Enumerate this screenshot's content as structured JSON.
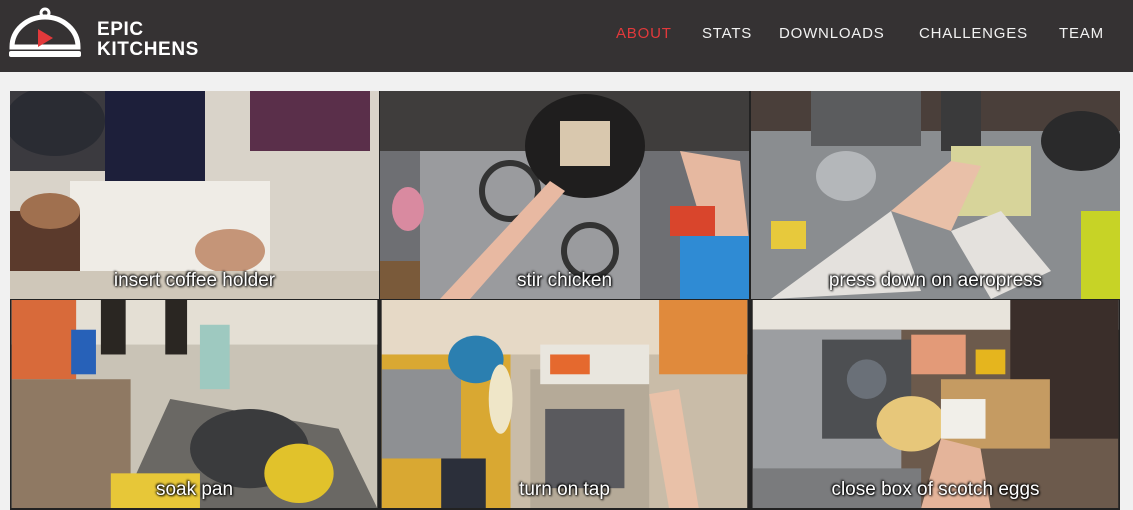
{
  "brand": {
    "line1": "EPIC",
    "line2": "KITCHENS",
    "logo_icon": "cloche-play-icon",
    "accent_color": "#e2393b"
  },
  "nav": {
    "items": [
      {
        "label": "ABOUT",
        "active": true
      },
      {
        "label": "STATS",
        "active": false
      },
      {
        "label": "DOWNLOADS",
        "active": false
      },
      {
        "label": "CHALLENGES",
        "active": false
      },
      {
        "label": "TEAM",
        "active": false
      }
    ]
  },
  "videos": [
    {
      "caption": "insert coffee holder"
    },
    {
      "caption": "stir chicken"
    },
    {
      "caption": "press down on aeropress"
    },
    {
      "caption": "soak pan"
    },
    {
      "caption": "turn on tap"
    },
    {
      "caption": "close box of scotch eggs"
    }
  ]
}
